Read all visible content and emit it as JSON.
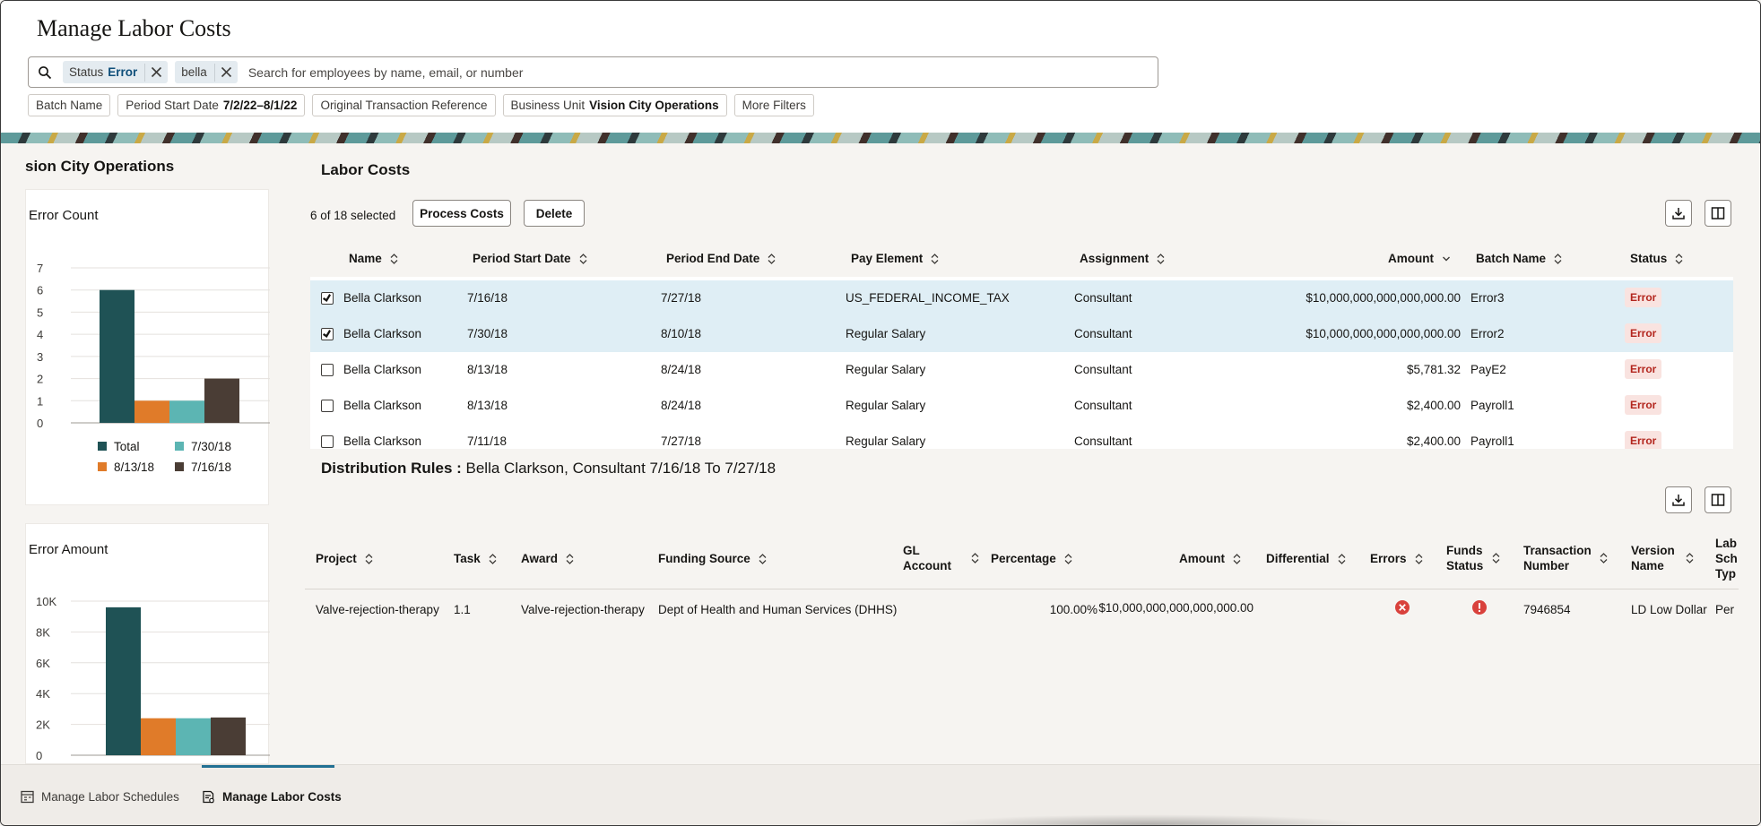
{
  "page": {
    "title": "Manage Labor Costs"
  },
  "search": {
    "chips": [
      {
        "label": "Status",
        "value": "Error"
      },
      {
        "label": "bella",
        "value": ""
      }
    ],
    "placeholder": "Search for employees by name, email, or number"
  },
  "filters": [
    {
      "label": "Batch Name",
      "value": ""
    },
    {
      "label": "Period Start Date",
      "value": "7/2/22–8/1/22"
    },
    {
      "label": "Original Transaction Reference",
      "value": ""
    },
    {
      "label": "Business Unit",
      "value": "Vision City Operations"
    },
    {
      "label": "More Filters",
      "value": ""
    }
  ],
  "left_panel": {
    "title": "sion City Operations"
  },
  "error_count_chart": {
    "title": "Error Count",
    "chart_data": {
      "type": "bar",
      "title": "Error Count",
      "categories": [
        "Total",
        "8/13/18",
        "7/30/18",
        "7/16/18"
      ],
      "values": [
        6,
        1,
        1,
        2
      ],
      "colors": [
        "#1f5255",
        "#e07b29",
        "#5cb5b3",
        "#4a3d35"
      ],
      "ylim": [
        0,
        7
      ],
      "yticks": [
        "0",
        "1",
        "2",
        "3",
        "4",
        "5",
        "6",
        "7"
      ],
      "grid": true,
      "legend": [
        "Total",
        "7/30/18",
        "8/13/18",
        "7/16/18"
      ],
      "legend_colors": [
        "#1f5255",
        "#5cb5b3",
        "#e07b29",
        "#4a3d35"
      ],
      "legend_position": "bottom"
    }
  },
  "error_amount_chart": {
    "title": "Error Amount",
    "chart_data": {
      "type": "bar",
      "title": "Error Amount",
      "categories": [
        "Total",
        "8/13/18",
        "7/30/18",
        "7/16/18"
      ],
      "values": [
        9600,
        2400,
        2400,
        2450
      ],
      "colors": [
        "#1f5255",
        "#e07b29",
        "#5cb5b3",
        "#4a3d35"
      ],
      "ylim": [
        0,
        10000
      ],
      "yticks": [
        "0",
        "2K",
        "4K",
        "6K",
        "8K",
        "10K"
      ],
      "grid": true
    }
  },
  "labor_costs": {
    "title": "Labor Costs",
    "selected_text": "6 of 18 selected",
    "process_label": "Process Costs",
    "delete_label": "Delete",
    "columns": [
      "Name",
      "Period Start Date",
      "Period End Date",
      "Pay Element",
      "Assignment",
      "Amount",
      "Batch Name",
      "Status"
    ],
    "rows": [
      {
        "selected": true,
        "name": "Bella Clarkson",
        "start": "7/16/18",
        "end": "7/27/18",
        "pay_element": "US_FEDERAL_INCOME_TAX",
        "assignment": "Consultant",
        "amount": "$10,000,000,000,000,000.00",
        "batch": "Error3",
        "status": "Error"
      },
      {
        "selected": true,
        "name": "Bella Clarkson",
        "start": "7/30/18",
        "end": "8/10/18",
        "pay_element": "Regular Salary",
        "assignment": "Consultant",
        "amount": "$10,000,000,000,000,000.00",
        "batch": "Error2",
        "status": "Error"
      },
      {
        "selected": false,
        "name": "Bella Clarkson",
        "start": "8/13/18",
        "end": "8/24/18",
        "pay_element": "Regular Salary",
        "assignment": "Consultant",
        "amount": "$5,781.32",
        "batch": "PayE2",
        "status": "Error"
      },
      {
        "selected": false,
        "name": "Bella Clarkson",
        "start": "8/13/18",
        "end": "8/24/18",
        "pay_element": "Regular Salary",
        "assignment": "Consultant",
        "amount": "$2,400.00",
        "batch": "Payroll1",
        "status": "Error"
      },
      {
        "selected": false,
        "name": "Bella Clarkson",
        "start": "7/11/18",
        "end": "7/27/18",
        "pay_element": "Regular Salary",
        "assignment": "Consultant",
        "amount": "$2,400.00",
        "batch": "Payroll1",
        "status": "Error"
      }
    ]
  },
  "distribution": {
    "title_bold": "Distribution Rules :",
    "title_rest": "Bella Clarkson, Consultant 7/16/18 To 7/27/18",
    "columns": {
      "project": "Project",
      "task": "Task",
      "award": "Award",
      "funding": "Funding Source",
      "gl_1": "GL",
      "gl_2": "Account",
      "percentage": "Percentage",
      "amount": "Amount",
      "differential": "Differential",
      "errors": "Errors",
      "funds_1": "Funds",
      "funds_2": "Status",
      "txn_1": "Transaction",
      "txn_2": "Number",
      "ver_1": "Version",
      "ver_2": "Name",
      "lab_1": "Lab",
      "lab_2": "Sch",
      "lab_3": "Typ"
    },
    "row": {
      "project": "Valve-rejection-therapy",
      "task": "1.1",
      "award": "Valve-rejection-therapy",
      "funding": "Dept of Health and Human Services (DHHS)",
      "percentage": "100.00%",
      "amount": "$10,000,000,000,000,000.00",
      "txn": "7946854",
      "version": "LD Low Dollar",
      "labor": "Per"
    }
  },
  "bottom_tabs": [
    {
      "label": "Manage Labor Schedules",
      "active": false
    },
    {
      "label": "Manage Labor Costs",
      "active": true
    }
  ],
  "colors": {
    "accent": "#227093",
    "error": "#b3261e",
    "error_bg": "#f9e3e0",
    "selected_row": "#dfeef5"
  }
}
